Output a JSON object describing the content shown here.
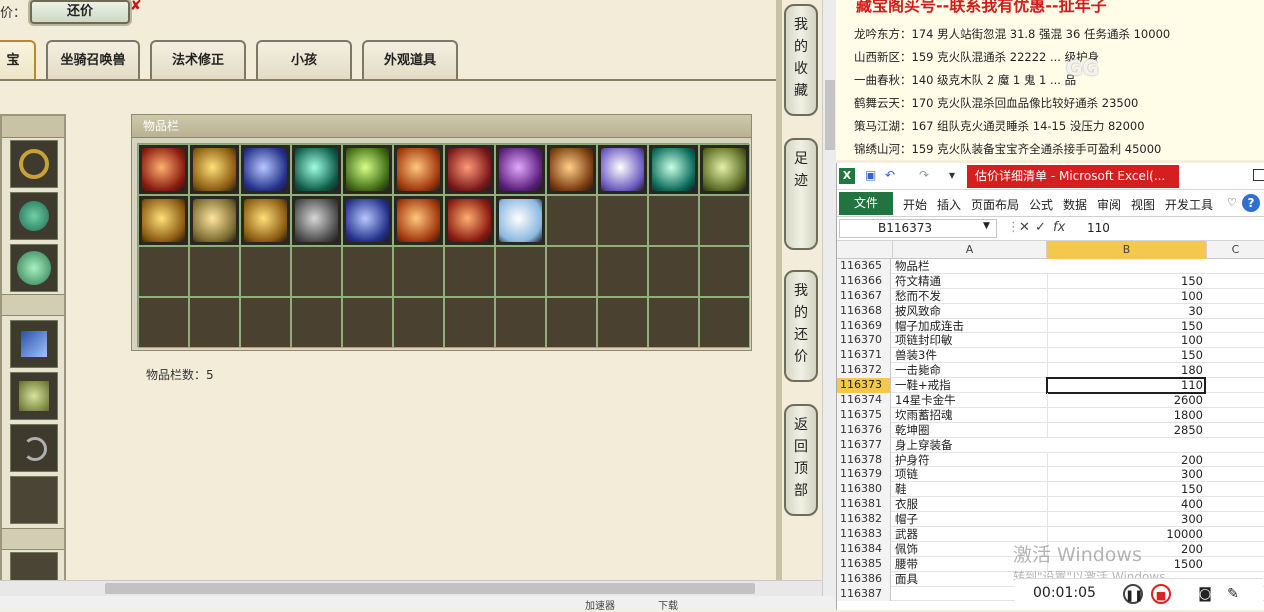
{
  "game": {
    "price_label": "价：",
    "counter_button": "还价",
    "close_mark": "✘",
    "tabs": [
      {
        "label": "宝",
        "active": true
      },
      {
        "label": "坐骑召唤兽",
        "active": false
      },
      {
        "label": "法术修正",
        "active": false
      },
      {
        "label": "小孩",
        "active": false
      },
      {
        "label": "外观道具",
        "active": false
      }
    ],
    "inventory_title": "物品栏",
    "inventory_count": "物品栏数：5",
    "items_row1": [
      "red",
      "gold",
      "blue",
      "teal",
      "green",
      "orange",
      "crimson",
      "violet",
      "amber",
      "lilac",
      "jade",
      "olive"
    ],
    "items_row2": [
      "gold",
      "tan",
      "gold",
      "gray",
      "blue",
      "orange",
      "red",
      "white"
    ],
    "side_buttons": [
      "我的收藏",
      "足迹",
      "我的还价",
      "返回顶部"
    ]
  },
  "status_bar": [
    "加速器",
    "下载"
  ],
  "info": {
    "title": "藏宝阁买号--联系我有优惠--扯年子",
    "lines": [
      "龙吟东方：174 男人站街忽混 31.8 强混 36 任务通杀 10000",
      "山西新区：159 克火队混通杀 22222 ... 级护身",
      "一曲春秋：140 级克木队 2 魔 1 鬼 1 ... 品",
      "鹤舞云天：170 克火队混杀回血品像比较好通杀 23500",
      "策马江湖：167 组队克火通灵睡杀 14-15 没压力 82000",
      "锦绣山河：159 克火队装备宝宝齐全通杀接手可盈利 45000"
    ],
    "watermark": "GG"
  },
  "excel": {
    "doc_title": "估价详细清单 - Microsoft Excel(...",
    "file_tab": "文件",
    "ribbon_tabs": [
      "开始",
      "插入",
      "页面布局",
      "公式",
      "数据",
      "审阅",
      "视图",
      "开发工具"
    ],
    "name_box": "B116373",
    "formula_value": "110",
    "col_a": "A",
    "col_b": "B",
    "col_c": "C",
    "selected_row": "116373",
    "rows": [
      {
        "n": "116365",
        "a": "物品栏",
        "b": ""
      },
      {
        "n": "116366",
        "a": "符文精通",
        "b": "150"
      },
      {
        "n": "116367",
        "a": "愁而不发",
        "b": "100"
      },
      {
        "n": "116368",
        "a": "披风致命",
        "b": "30"
      },
      {
        "n": "116369",
        "a": "帽子加成连击",
        "b": "150"
      },
      {
        "n": "116370",
        "a": "项链封印敏",
        "b": "100"
      },
      {
        "n": "116371",
        "a": "兽装3件",
        "b": "150"
      },
      {
        "n": "116372",
        "a": "一击毙命",
        "b": "180"
      },
      {
        "n": "116373",
        "a": "一鞋+戒指",
        "b": "110"
      },
      {
        "n": "116374",
        "a": "14星卡金牛",
        "b": "2600"
      },
      {
        "n": "116375",
        "a": "坎雨蓄招魂",
        "b": "1800"
      },
      {
        "n": "116376",
        "a": "乾坤圈",
        "b": "2850"
      },
      {
        "n": "116377",
        "a": "身上穿装备",
        "b": ""
      },
      {
        "n": "116378",
        "a": "护身符",
        "b": "200"
      },
      {
        "n": "116379",
        "a": "项链",
        "b": "300"
      },
      {
        "n": "116380",
        "a": "鞋",
        "b": "150"
      },
      {
        "n": "116381",
        "a": "衣服",
        "b": "400"
      },
      {
        "n": "116382",
        "a": "帽子",
        "b": "300"
      },
      {
        "n": "116383",
        "a": "武器",
        "b": "10000"
      },
      {
        "n": "116384",
        "a": "佩饰",
        "b": "200"
      },
      {
        "n": "116385",
        "a": "腰带",
        "b": "1500"
      },
      {
        "n": "116386",
        "a": "面具",
        "b": ""
      },
      {
        "n": "116387",
        "a": "",
        "b": ""
      }
    ],
    "activate_title": "激活 Windows",
    "activate_sub": "转到\"设置\"以激活 Windows。",
    "timer": "00:01:05"
  }
}
